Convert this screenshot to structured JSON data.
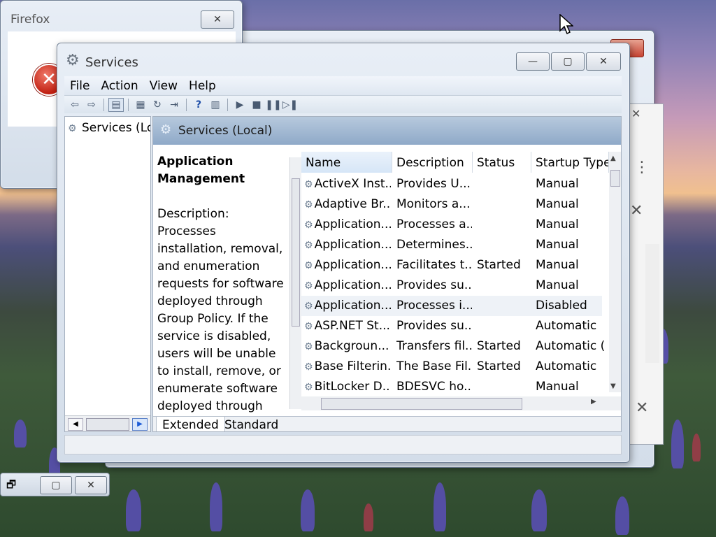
{
  "firefox_dialog": {
    "title": "Firefox"
  },
  "services": {
    "title": "Services",
    "menu": [
      "File",
      "Action",
      "View",
      "Help"
    ],
    "tree_item": "Services (Local)",
    "header": "Services (Local)",
    "detail": {
      "name": "Application Management",
      "description_label": "Description:",
      "description": "Processes installation, removal, and enumeration requests for software deployed through Group Policy. If the service is disabled, users will be unable to install, remove, or enumerate software deployed through Group Policy"
    },
    "columns": [
      "Name",
      "Description",
      "Status",
      "Startup Type"
    ],
    "rows": [
      {
        "name": "ActiveX Inst...",
        "description": "Provides U...",
        "status": "",
        "startup": "Manual"
      },
      {
        "name": "Adaptive Br...",
        "description": "Monitors a...",
        "status": "",
        "startup": "Manual"
      },
      {
        "name": "Application...",
        "description": "Processes a...",
        "status": "",
        "startup": "Manual"
      },
      {
        "name": "Application...",
        "description": "Determines...",
        "status": "",
        "startup": "Manual"
      },
      {
        "name": "Application...",
        "description": "Facilitates t...",
        "status": "Started",
        "startup": "Manual"
      },
      {
        "name": "Application...",
        "description": "Provides su...",
        "status": "",
        "startup": "Manual"
      },
      {
        "name": "Application...",
        "description": "Processes i...",
        "status": "",
        "startup": "Disabled"
      },
      {
        "name": "ASP.NET St...",
        "description": "Provides su...",
        "status": "",
        "startup": "Automatic"
      },
      {
        "name": "Backgroun...",
        "description": "Transfers fil...",
        "status": "Started",
        "startup": "Automatic (..."
      },
      {
        "name": "Base Filterin...",
        "description": "The Base Fil...",
        "status": "Started",
        "startup": "Automatic"
      },
      {
        "name": "BitLocker D...",
        "description": "BDESVC ho...",
        "status": "",
        "startup": "Manual"
      }
    ],
    "tabs": [
      "Extended",
      "Standard"
    ]
  },
  "colors": {
    "header_blue": "#8fa9c8",
    "error_red": "#c01e10"
  }
}
